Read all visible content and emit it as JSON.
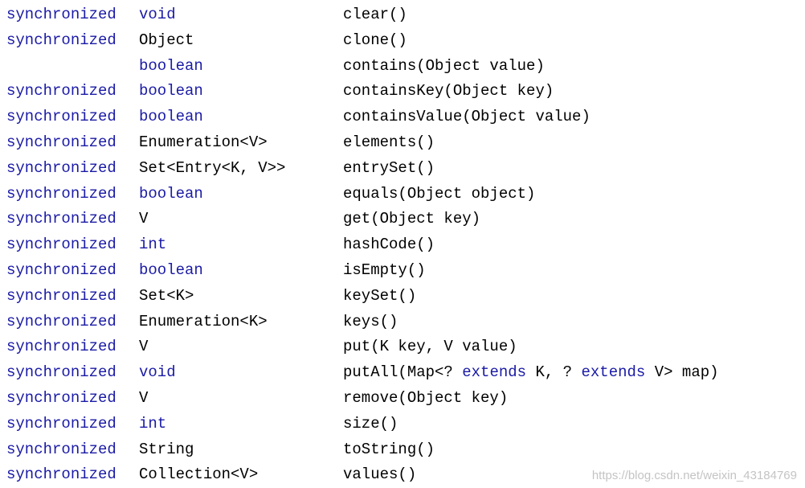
{
  "rows": [
    {
      "modifier": "synchronized",
      "return_type": "void",
      "return_is_keyword": true,
      "signature": [
        {
          "text": "clear()",
          "kw": false
        }
      ]
    },
    {
      "modifier": "synchronized",
      "return_type": "Object",
      "return_is_keyword": false,
      "signature": [
        {
          "text": "clone()",
          "kw": false
        }
      ]
    },
    {
      "modifier": "",
      "return_type": "boolean",
      "return_is_keyword": true,
      "signature": [
        {
          "text": "contains(Object value)",
          "kw": false
        }
      ]
    },
    {
      "modifier": "synchronized",
      "return_type": "boolean",
      "return_is_keyword": true,
      "signature": [
        {
          "text": "containsKey(Object key)",
          "kw": false
        }
      ]
    },
    {
      "modifier": "synchronized",
      "return_type": "boolean",
      "return_is_keyword": true,
      "signature": [
        {
          "text": "containsValue(Object value)",
          "kw": false
        }
      ]
    },
    {
      "modifier": "synchronized",
      "return_type": "Enumeration<V>",
      "return_is_keyword": false,
      "signature": [
        {
          "text": "elements()",
          "kw": false
        }
      ]
    },
    {
      "modifier": "synchronized",
      "return_type": "Set<Entry<K, V>>",
      "return_is_keyword": false,
      "signature": [
        {
          "text": "entrySet()",
          "kw": false
        }
      ]
    },
    {
      "modifier": "synchronized",
      "return_type": "boolean",
      "return_is_keyword": true,
      "signature": [
        {
          "text": "equals(Object object)",
          "kw": false
        }
      ]
    },
    {
      "modifier": "synchronized",
      "return_type": "V",
      "return_is_keyword": false,
      "signature": [
        {
          "text": "get(Object key)",
          "kw": false
        }
      ]
    },
    {
      "modifier": "synchronized",
      "return_type": "int",
      "return_is_keyword": true,
      "signature": [
        {
          "text": "hashCode()",
          "kw": false
        }
      ]
    },
    {
      "modifier": "synchronized",
      "return_type": "boolean",
      "return_is_keyword": true,
      "signature": [
        {
          "text": "isEmpty()",
          "kw": false
        }
      ]
    },
    {
      "modifier": "synchronized",
      "return_type": "Set<K>",
      "return_is_keyword": false,
      "signature": [
        {
          "text": "keySet()",
          "kw": false
        }
      ]
    },
    {
      "modifier": "synchronized",
      "return_type": "Enumeration<K>",
      "return_is_keyword": false,
      "signature": [
        {
          "text": "keys()",
          "kw": false
        }
      ]
    },
    {
      "modifier": "synchronized",
      "return_type": "V",
      "return_is_keyword": false,
      "signature": [
        {
          "text": "put(K key, V value)",
          "kw": false
        }
      ]
    },
    {
      "modifier": "synchronized",
      "return_type": "void",
      "return_is_keyword": true,
      "signature": [
        {
          "text": "putAll(Map<? ",
          "kw": false
        },
        {
          "text": "extends",
          "kw": true
        },
        {
          "text": " K, ? ",
          "kw": false
        },
        {
          "text": "extends",
          "kw": true
        },
        {
          "text": " V> map)",
          "kw": false
        }
      ]
    },
    {
      "modifier": "synchronized",
      "return_type": "V",
      "return_is_keyword": false,
      "signature": [
        {
          "text": "remove(Object key)",
          "kw": false
        }
      ]
    },
    {
      "modifier": "synchronized",
      "return_type": "int",
      "return_is_keyword": true,
      "signature": [
        {
          "text": "size()",
          "kw": false
        }
      ]
    },
    {
      "modifier": "synchronized",
      "return_type": "String",
      "return_is_keyword": false,
      "signature": [
        {
          "text": "toString()",
          "kw": false
        }
      ]
    },
    {
      "modifier": "synchronized",
      "return_type": "Collection<V>",
      "return_is_keyword": false,
      "signature": [
        {
          "text": "values()",
          "kw": false
        }
      ]
    }
  ],
  "watermark": "https://blog.csdn.net/weixin_43184769",
  "colors": {
    "keyword": "#1a1aa6",
    "text": "#000000",
    "watermark": "#c4c4c4",
    "background": "#ffffff"
  }
}
